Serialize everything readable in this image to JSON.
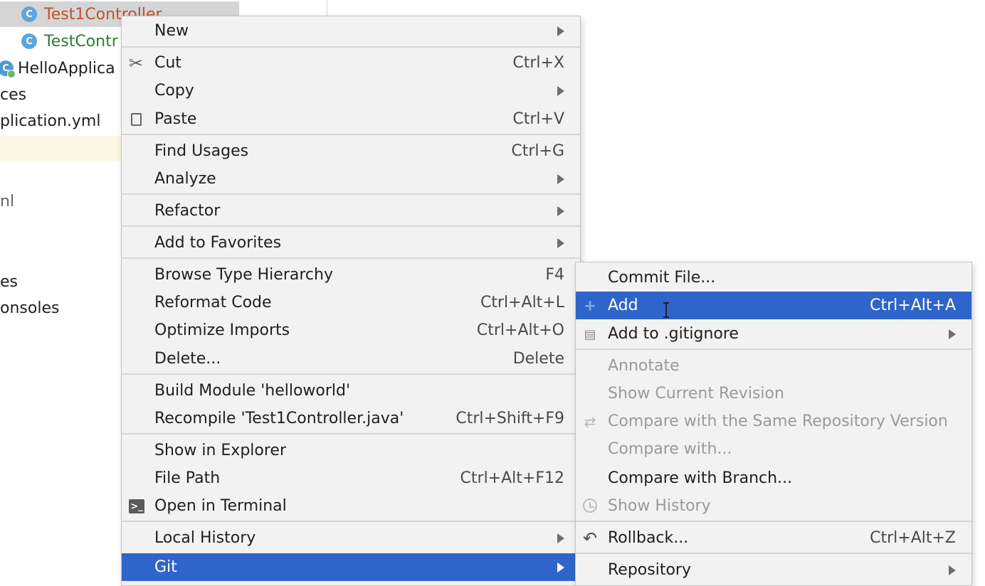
{
  "project_tree": {
    "items": [
      {
        "label": "Test1Controller",
        "icon": "class-icon",
        "icon_letter": "C",
        "color": "#c0542b",
        "selected": true
      },
      {
        "label": "TestContr",
        "icon": "class-icon",
        "icon_letter": "C",
        "color": "#2e7d32"
      },
      {
        "label": "HelloApplica",
        "icon": "spring-class-icon",
        "icon_letter": "C"
      },
      {
        "label": "ces"
      },
      {
        "label": "plication.yml"
      },
      {
        "label": ""
      },
      {
        "label": "nl"
      },
      {
        "label": "es"
      },
      {
        "label": "onsoles"
      }
    ]
  },
  "context_menu": {
    "items": [
      {
        "label": "New",
        "submenu": true
      },
      {
        "label": "Cut",
        "shortcut": "Ctrl+X",
        "icon": "scissors-icon"
      },
      {
        "label": "Copy",
        "submenu": true
      },
      {
        "label": "Paste",
        "shortcut": "Ctrl+V",
        "icon": "clipboard-icon"
      },
      {
        "label": "Find Usages",
        "shortcut": "Ctrl+G"
      },
      {
        "label": "Analyze",
        "submenu": true
      },
      {
        "label": "Refactor",
        "submenu": true
      },
      {
        "label": "Add to Favorites",
        "submenu": true
      },
      {
        "label": "Browse Type Hierarchy",
        "shortcut": "F4"
      },
      {
        "label": "Reformat Code",
        "shortcut": "Ctrl+Alt+L"
      },
      {
        "label": "Optimize Imports",
        "shortcut": "Ctrl+Alt+O"
      },
      {
        "label": "Delete...",
        "shortcut": "Delete"
      },
      {
        "label": "Build Module 'helloworld'"
      },
      {
        "label": "Recompile 'Test1Controller.java'",
        "shortcut": "Ctrl+Shift+F9"
      },
      {
        "label": "Show in Explorer"
      },
      {
        "label": "File Path",
        "shortcut": "Ctrl+Alt+F12"
      },
      {
        "label": "Open in Terminal",
        "icon": "terminal-icon"
      },
      {
        "label": "Local History",
        "submenu": true
      },
      {
        "label": "Git",
        "submenu": true,
        "selected": true
      }
    ]
  },
  "git_menu": {
    "items": [
      {
        "label": "Commit File..."
      },
      {
        "label": "Add",
        "shortcut": "Ctrl+Alt+A",
        "icon": "plus-icon",
        "selected": true
      },
      {
        "label": "Add to .gitignore",
        "submenu": true,
        "icon": "gitignore-icon"
      },
      {
        "label": "Annotate",
        "disabled": true
      },
      {
        "label": "Show Current Revision",
        "disabled": true
      },
      {
        "label": "Compare with the Same Repository Version",
        "disabled": true,
        "icon": "compare-icon"
      },
      {
        "label": "Compare with...",
        "disabled": true
      },
      {
        "label": "Compare with Branch..."
      },
      {
        "label": "Show History",
        "disabled": true,
        "icon": "clock-icon"
      },
      {
        "label": "Rollback...",
        "shortcut": "Ctrl+Alt+Z",
        "icon": "rollback-icon"
      },
      {
        "label": "Repository",
        "submenu": true
      }
    ]
  },
  "colors": {
    "selection": "#2f65ca",
    "menu_background": "#f2f2f2",
    "disabled_text": "#9a9a9a",
    "tree_selected_row": "#d5d5d5"
  }
}
